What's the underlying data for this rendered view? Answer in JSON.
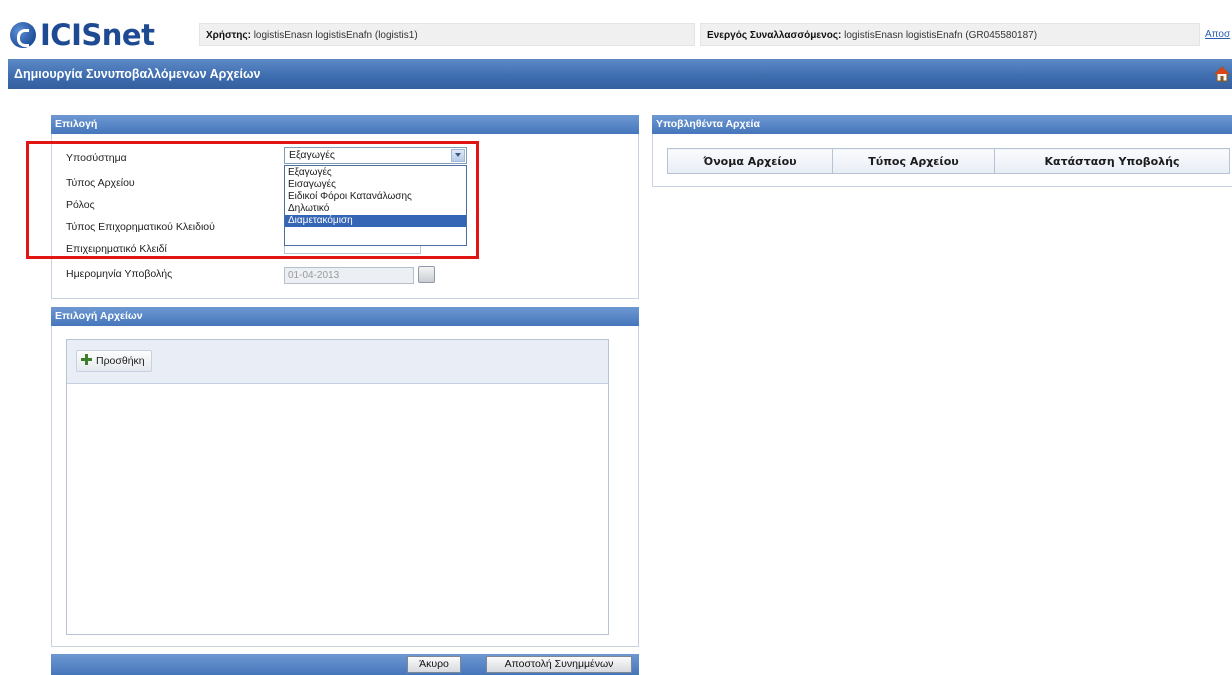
{
  "header": {
    "logo_text": "ICISnet",
    "user_label": "Χρήστης:",
    "user_value": " logistisEnasn logistisEnafn (logistis1)",
    "active_label": "Ενεργός Συναλλασσόμενος:",
    "active_value": " logistisEnasn logistisEnafn (GR045580187)",
    "logout_label": "Αποσ"
  },
  "page_title": "Δημιουργία Συνυποβαλλόμενων Αρχείων",
  "selection_panel": {
    "title": "Επιλογή",
    "labels": [
      "Υποσύστημα",
      "Τύπος Αρχείου",
      "Ρόλος",
      "Τύπος Επιχορηματικού Κλειδιού",
      "Επιχειρηματικό Κλειδί",
      "Ημερομηνία Υποβολής"
    ],
    "subsystem_value": "Εξαγωγές",
    "dropdown_options": [
      "Εξαγωγές",
      "Εισαγωγές",
      "Ειδικοί Φόροι Κατανάλωσης",
      "Δηλωτικό",
      "Διαμετακόμιση"
    ],
    "selected_option_index": 4,
    "date_value": "01-04-2013"
  },
  "files_panel": {
    "title": "Επιλογή Αρχείων",
    "add_label": "Προσθήκη"
  },
  "footer": {
    "cancel_label": "Άκυρο",
    "send_label": "Αποστολή Συνημμένων"
  },
  "submitted_panel": {
    "title": "Υποβληθέντα Αρχεία",
    "columns": [
      "Όνομα Αρχείου",
      "Τύπος Αρχείου",
      "Κατάσταση Υποβολής"
    ]
  },
  "colors": {
    "title_bar": "#3f6eb0",
    "panel_header": "#4576bb",
    "highlight": "#e21414",
    "selected_option": "#3566b5"
  }
}
